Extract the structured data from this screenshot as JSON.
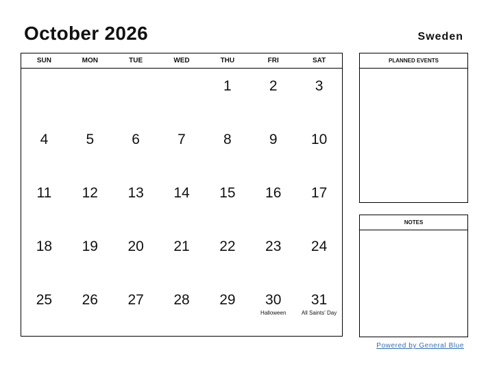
{
  "header": {
    "title": "October 2026",
    "country": "Sweden"
  },
  "calendar": {
    "weekdays": [
      "SUN",
      "MON",
      "TUE",
      "WED",
      "THU",
      "FRI",
      "SAT"
    ],
    "weeks": [
      [
        {
          "day": ""
        },
        {
          "day": ""
        },
        {
          "day": ""
        },
        {
          "day": ""
        },
        {
          "day": "1"
        },
        {
          "day": "2"
        },
        {
          "day": "3"
        }
      ],
      [
        {
          "day": "4"
        },
        {
          "day": "5"
        },
        {
          "day": "6"
        },
        {
          "day": "7"
        },
        {
          "day": "8"
        },
        {
          "day": "9"
        },
        {
          "day": "10"
        }
      ],
      [
        {
          "day": "11"
        },
        {
          "day": "12"
        },
        {
          "day": "13"
        },
        {
          "day": "14"
        },
        {
          "day": "15"
        },
        {
          "day": "16"
        },
        {
          "day": "17"
        }
      ],
      [
        {
          "day": "18"
        },
        {
          "day": "19"
        },
        {
          "day": "20"
        },
        {
          "day": "21"
        },
        {
          "day": "22"
        },
        {
          "day": "23"
        },
        {
          "day": "24"
        }
      ],
      [
        {
          "day": "25"
        },
        {
          "day": "26"
        },
        {
          "day": "27"
        },
        {
          "day": "28"
        },
        {
          "day": "29"
        },
        {
          "day": "30",
          "event": "Halloween"
        },
        {
          "day": "31",
          "event": "All Saints' Day"
        }
      ]
    ]
  },
  "panels": {
    "planned_events_label": "PLANNED EVENTS",
    "notes_label": "NOTES"
  },
  "footer": {
    "link_text": "Powered by General Blue",
    "link_color": "#2f6db5"
  }
}
